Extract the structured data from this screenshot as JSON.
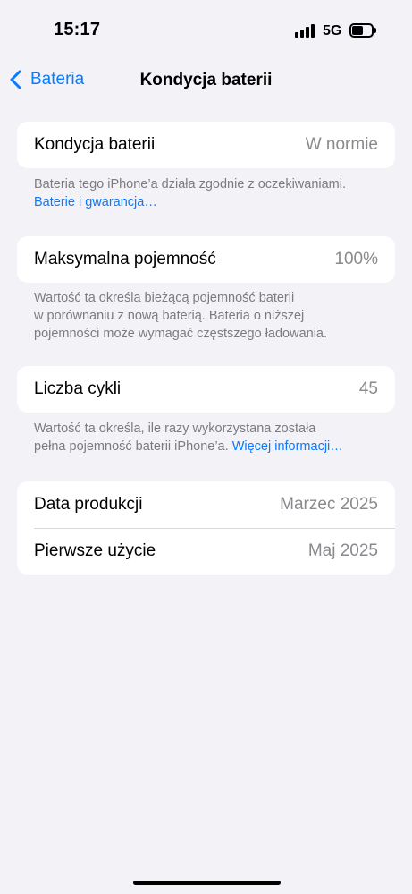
{
  "status_bar": {
    "time": "15:17",
    "network": "5G",
    "battery_level": 0.5
  },
  "nav": {
    "back_label": "Bateria",
    "title": "Kondycja baterii"
  },
  "sections": [
    {
      "label": "Kondycja baterii",
      "value": "W normie",
      "note": "Bateria tego iPhone’a działa zgodnie z oczekiwaniami.",
      "note_link": "Baterie i gwarancja…"
    },
    {
      "label": "Maksymalna pojemność",
      "value": "100%",
      "note_lines": [
        "Wartość ta określa bieżącą pojemność baterii",
        "w porównaniu z nową baterią. Bateria o niższej",
        "pojemności może wymagać częstszego ładowania."
      ]
    },
    {
      "label": "Liczba cykli",
      "value": "45",
      "note_line1": "Wartość ta określa, ile razy wykorzystana została",
      "note_line2": "pełna pojemność baterii iPhone’a.",
      "note_link": "Więcej informacji…"
    }
  ],
  "dates": [
    {
      "label": "Data produkcji",
      "value": "Marzec 2025"
    },
    {
      "label": "Pierwsze użycie",
      "value": "Maj 2025"
    }
  ],
  "colors": {
    "accent": "#0a7aff",
    "background": "#f2f2f7",
    "secondary_text": "#8a8a8e"
  }
}
